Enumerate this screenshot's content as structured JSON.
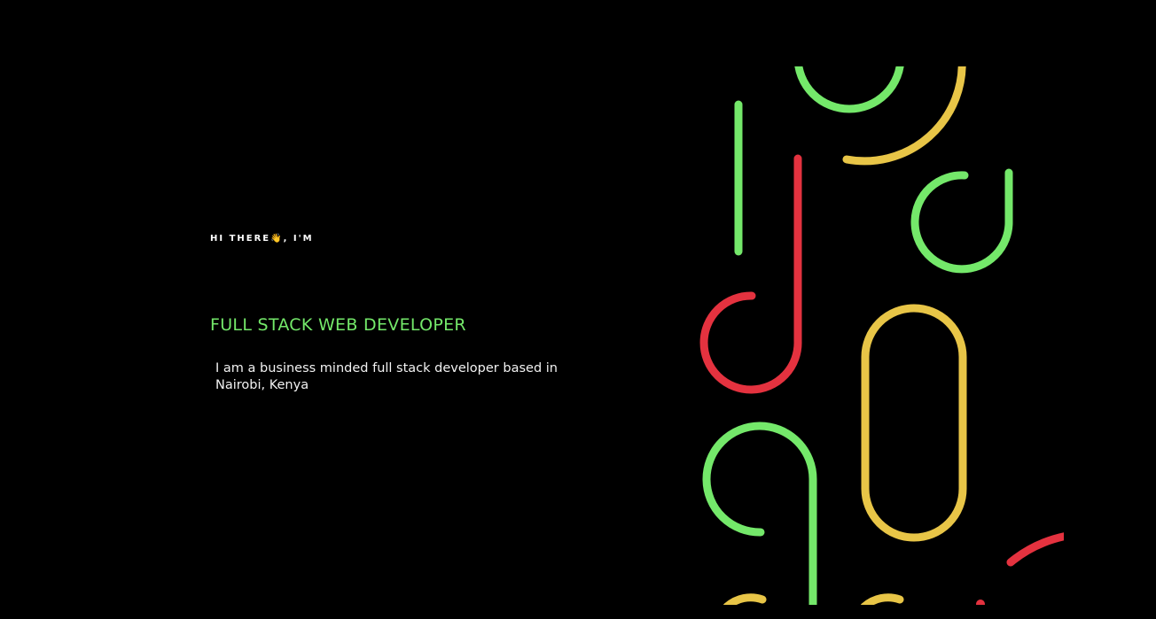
{
  "hero": {
    "greeting": "HI THERE👋, I'M",
    "role": "FULL STACK WEB DEVELOPER",
    "bio": "I am a business minded full stack developer based in Nairobi, Kenya"
  },
  "colors": {
    "background": "#000000",
    "accent_green": "#74e86a",
    "accent_yellow": "#e8c547",
    "accent_red": "#e4323f",
    "text": "#f2f2f2"
  },
  "illustration": {
    "icon": "abstract-line-art",
    "description_hidden": true
  }
}
